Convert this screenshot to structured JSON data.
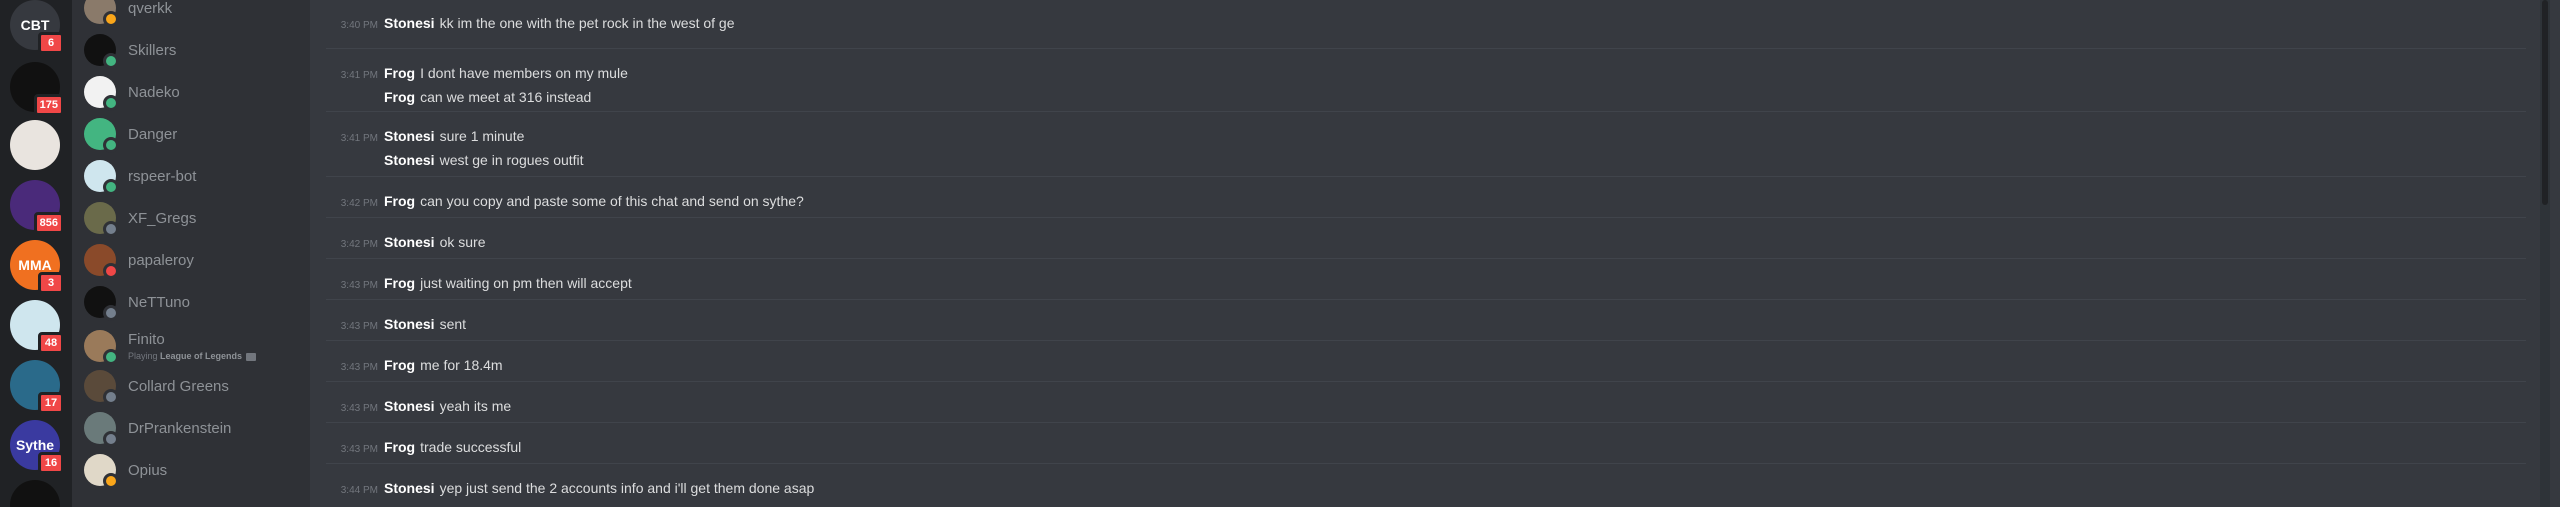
{
  "servers": [
    {
      "label": "CBT",
      "badge": "6",
      "bg": "#36393f"
    },
    {
      "label": "",
      "badge": "175",
      "bg": "#111111"
    },
    {
      "label": "",
      "badge": "",
      "bg": "#e9e4df"
    },
    {
      "label": "",
      "badge": "856",
      "bg": "#4a2a7a"
    },
    {
      "label": "MMA",
      "badge": "3",
      "bg": "#f07020"
    },
    {
      "label": "",
      "badge": "48",
      "bg": "#cfe6ee"
    },
    {
      "label": "",
      "badge": "17",
      "bg": "#2a6a8a"
    },
    {
      "label": "Sythe",
      "badge": "16",
      "bg": "#3a3aa0"
    },
    {
      "label": "",
      "badge": "",
      "bg": "#111111"
    }
  ],
  "members": [
    {
      "name": "qverkk",
      "activity": "",
      "status": "#faa61a",
      "avatar": "#8a7a6a"
    },
    {
      "name": "Skillers",
      "activity": "",
      "status": "#43b581",
      "avatar": "#111111"
    },
    {
      "name": "Nadeko",
      "activity": "",
      "status": "#43b581",
      "avatar": "#f2f2f2"
    },
    {
      "name": "Danger",
      "activity": "",
      "status": "#43b581",
      "avatar": "#43b581"
    },
    {
      "name": "rspeer-bot",
      "activity": "",
      "status": "#43b581",
      "avatar": "#cfe6ee"
    },
    {
      "name": "XF_Gregs",
      "activity": "",
      "status": "#747f8d",
      "avatar": "#6a6a4a"
    },
    {
      "name": "papaleroy",
      "activity": "",
      "status": "#f04747",
      "avatar": "#8a4a2a"
    },
    {
      "name": "NeTTuno",
      "activity": "",
      "status": "#747f8d",
      "avatar": "#111111"
    },
    {
      "name": "Finito",
      "activity_prefix": "Playing",
      "activity_game": "League of Legends",
      "status": "#43b581",
      "avatar": "#9a7a5a"
    },
    {
      "name": "Collard Greens",
      "activity": "",
      "status": "#747f8d",
      "avatar": "#5a4a3a"
    },
    {
      "name": "DrPrankenstein",
      "activity": "",
      "status": "#747f8d",
      "avatar": "#6a7a7a"
    },
    {
      "name": "Opius",
      "activity": "",
      "status": "#faa61a",
      "avatar": "#e0d8c8"
    }
  ],
  "messages": [
    {
      "lines": [
        {
          "time": "3:40 PM",
          "author": "Stonesi",
          "text": "kk im the one with the pet rock in the west of ge"
        }
      ]
    },
    {
      "lines": [
        {
          "time": "3:41 PM",
          "author": "Frog",
          "text": "I dont have members on my mule"
        },
        {
          "time": "",
          "author": "Frog",
          "text": "can we meet at 316 instead"
        }
      ]
    },
    {
      "lines": [
        {
          "time": "3:41 PM",
          "author": "Stonesi",
          "text": "sure 1 minute"
        },
        {
          "time": "",
          "author": "Stonesi",
          "text": "west ge in rogues outfit"
        }
      ]
    },
    {
      "lines": [
        {
          "time": "3:42 PM",
          "author": "Frog",
          "text": "can you copy and paste some of this chat and send on sythe?"
        }
      ]
    },
    {
      "lines": [
        {
          "time": "3:42 PM",
          "author": "Stonesi",
          "text": "ok sure"
        }
      ]
    },
    {
      "lines": [
        {
          "time": "3:43 PM",
          "author": "Frog",
          "text": "just waiting on pm then will accept"
        }
      ]
    },
    {
      "lines": [
        {
          "time": "3:43 PM",
          "author": "Stonesi",
          "text": "sent"
        }
      ]
    },
    {
      "lines": [
        {
          "time": "3:43 PM",
          "author": "Frog",
          "text": "me for 18.4m"
        }
      ]
    },
    {
      "lines": [
        {
          "time": "3:43 PM",
          "author": "Stonesi",
          "text": "yeah its me"
        }
      ]
    },
    {
      "lines": [
        {
          "time": "3:43 PM",
          "author": "Frog",
          "text": "trade successful"
        }
      ]
    },
    {
      "lines": [
        {
          "time": "3:44 PM",
          "author": "Stonesi",
          "text": "yep just send the 2 accounts info and i'll get them done asap"
        }
      ]
    }
  ]
}
